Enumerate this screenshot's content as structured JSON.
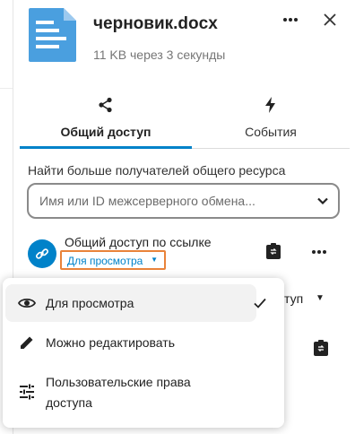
{
  "file": {
    "name": "черновик.docx",
    "meta": "11 KB через 3 секунды"
  },
  "tabs": [
    {
      "label": "Общий доступ",
      "icon": "share-icon",
      "active": true
    },
    {
      "label": "События",
      "icon": "lightning-icon",
      "active": false
    }
  ],
  "search": {
    "label": "Найти больше получателей общего ресурса",
    "placeholder": "Имя или ID межсерверного обмена..."
  },
  "link_share": {
    "title": "Общий доступ по ссылке",
    "permission": "Для просмотра"
  },
  "background_row": {
    "partial_label": "ступ"
  },
  "permission_menu": {
    "items": [
      {
        "label": "Для просмотра",
        "icon": "eye-icon",
        "selected": true
      },
      {
        "label": "Можно редактировать",
        "icon": "pencil-icon",
        "selected": false
      },
      {
        "label": "Пользовательские права",
        "label2": "доступа",
        "icon": "tune-icon",
        "selected": false
      }
    ]
  },
  "colors": {
    "accent": "#0082c9",
    "focus_outline": "#e9833a",
    "file_icon": "#4a9fdf"
  }
}
